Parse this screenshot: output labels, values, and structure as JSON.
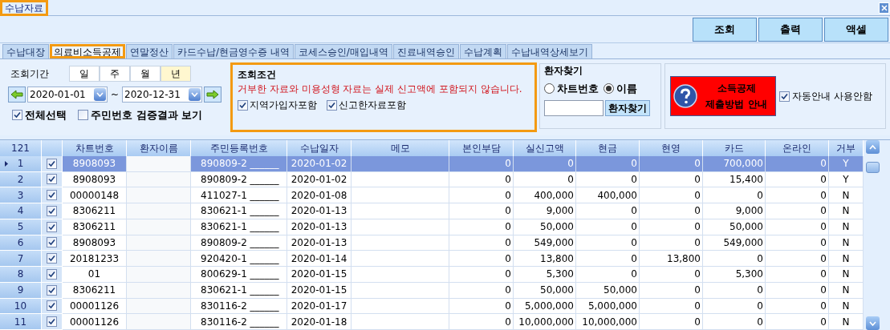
{
  "window": {
    "title": "수납자료",
    "highlighted": true
  },
  "toolbar": [
    "조회",
    "출력",
    "액셀"
  ],
  "tabs": [
    {
      "label": "수납대장",
      "selected": false,
      "highlighted": false
    },
    {
      "label": "의료비소득공제",
      "selected": true,
      "highlighted": true
    },
    {
      "label": "연말정산",
      "selected": false,
      "highlighted": false
    },
    {
      "label": "카드수납/현금영수증 내역",
      "selected": false,
      "highlighted": false
    },
    {
      "label": "코세스승인/매입내역",
      "selected": false,
      "highlighted": false
    },
    {
      "label": "진료내역승인",
      "selected": false,
      "highlighted": false
    },
    {
      "label": "수납계획",
      "selected": false,
      "highlighted": false
    },
    {
      "label": "수납내역상세보기",
      "selected": false,
      "highlighted": false
    }
  ],
  "period": {
    "label": "조회기간",
    "units": [
      {
        "label": "일",
        "selected": false
      },
      {
        "label": "주",
        "selected": false
      },
      {
        "label": "월",
        "selected": false
      },
      {
        "label": "년",
        "selected": true
      }
    ],
    "start": "2020-01-01",
    "separator": "~",
    "end": "2020-12-31"
  },
  "options": [
    {
      "label": "전체선택",
      "checked": true
    },
    {
      "label": "주민번호 검증결과 보기",
      "checked": false
    }
  ],
  "conditions": {
    "title": "조회조건",
    "highlighted": true,
    "notice": "거부한 자료와 미용성형 자료는 실제 신고액에 포함되지 않습니다.",
    "checks": [
      {
        "label": "지역가입자포함",
        "checked": true
      },
      {
        "label": "신고한자료포함",
        "checked": true
      }
    ]
  },
  "patient_search": {
    "title": "환자찾기",
    "radios": [
      {
        "label": "차트번호",
        "selected": false
      },
      {
        "label": "이름",
        "selected": true
      }
    ],
    "button": "환자찾기"
  },
  "guide": {
    "lines": [
      "소득공제",
      "제출방법 안내"
    ],
    "auto_check": {
      "label": "자동안내 사용안함",
      "checked": true
    }
  },
  "table": {
    "count": "121",
    "columns": [
      "차트번호",
      "환자이름",
      "주민등록번호",
      "수납일자",
      "메모",
      "본인부담",
      "실신고액",
      "현금",
      "현영",
      "카드",
      "온라인",
      "거부"
    ],
    "rows": [
      {
        "number": "1",
        "checked": true,
        "selected": true,
        "chart": "8908093",
        "rrn": "890809-2 ______",
        "date": "2020-01-02",
        "amounts": [
          "0",
          "0",
          "0",
          "0",
          "700,000",
          "0"
        ],
        "refused": "Y"
      },
      {
        "number": "2",
        "checked": true,
        "selected": false,
        "chart": "8908093",
        "rrn": "890809-2 ______",
        "date": "2020-01-02",
        "amounts": [
          "0",
          "0",
          "0",
          "0",
          "15,400",
          "0"
        ],
        "refused": "Y"
      },
      {
        "number": "3",
        "checked": true,
        "selected": false,
        "chart": "00000148",
        "rrn": "411027-1 ______",
        "date": "2020-01-08",
        "amounts": [
          "0",
          "400,000",
          "400,000",
          "0",
          "0",
          "0"
        ],
        "refused": "N"
      },
      {
        "number": "4",
        "checked": true,
        "selected": false,
        "chart": "8306211",
        "rrn": "830621-1 ______",
        "date": "2020-01-13",
        "amounts": [
          "0",
          "9,000",
          "0",
          "0",
          "9,000",
          "0"
        ],
        "refused": "N"
      },
      {
        "number": "5",
        "checked": true,
        "selected": false,
        "chart": "8306211",
        "rrn": "830621-1 ______",
        "date": "2020-01-13",
        "amounts": [
          "0",
          "50,000",
          "0",
          "0",
          "50,000",
          "0"
        ],
        "refused": "N"
      },
      {
        "number": "6",
        "checked": true,
        "selected": false,
        "chart": "8908093",
        "rrn": "890809-2 ______",
        "date": "2020-01-13",
        "amounts": [
          "0",
          "549,000",
          "0",
          "0",
          "549,000",
          "0"
        ],
        "refused": "N"
      },
      {
        "number": "7",
        "checked": true,
        "selected": false,
        "chart": "20181233",
        "rrn": "920420-1 ______",
        "date": "2020-01-14",
        "amounts": [
          "0",
          "13,800",
          "0",
          "13,800",
          "0",
          "0"
        ],
        "refused": "N"
      },
      {
        "number": "8",
        "checked": true,
        "selected": false,
        "chart": "01",
        "rrn": "800629-1 ______",
        "date": "2020-01-15",
        "amounts": [
          "0",
          "5,300",
          "0",
          "0",
          "5,300",
          "0"
        ],
        "refused": "N"
      },
      {
        "number": "9",
        "checked": true,
        "selected": false,
        "chart": "8306211",
        "rrn": "830621-1 ______",
        "date": "2020-01-15",
        "amounts": [
          "0",
          "50,000",
          "50,000",
          "0",
          "0",
          "0"
        ],
        "refused": "N"
      },
      {
        "number": "10",
        "checked": true,
        "selected": false,
        "chart": "00001126",
        "rrn": "830116-2 ______",
        "date": "2020-01-17",
        "amounts": [
          "0",
          "5,000,000",
          "5,000,000",
          "0",
          "0",
          "0"
        ],
        "refused": "N"
      },
      {
        "number": "11",
        "checked": true,
        "selected": false,
        "chart": "00001126",
        "rrn": "830116-2 ______",
        "date": "2020-01-18",
        "amounts": [
          "0",
          "10,000,000",
          "10,000,000",
          "0",
          "0",
          "0"
        ],
        "refused": "N"
      }
    ]
  }
}
